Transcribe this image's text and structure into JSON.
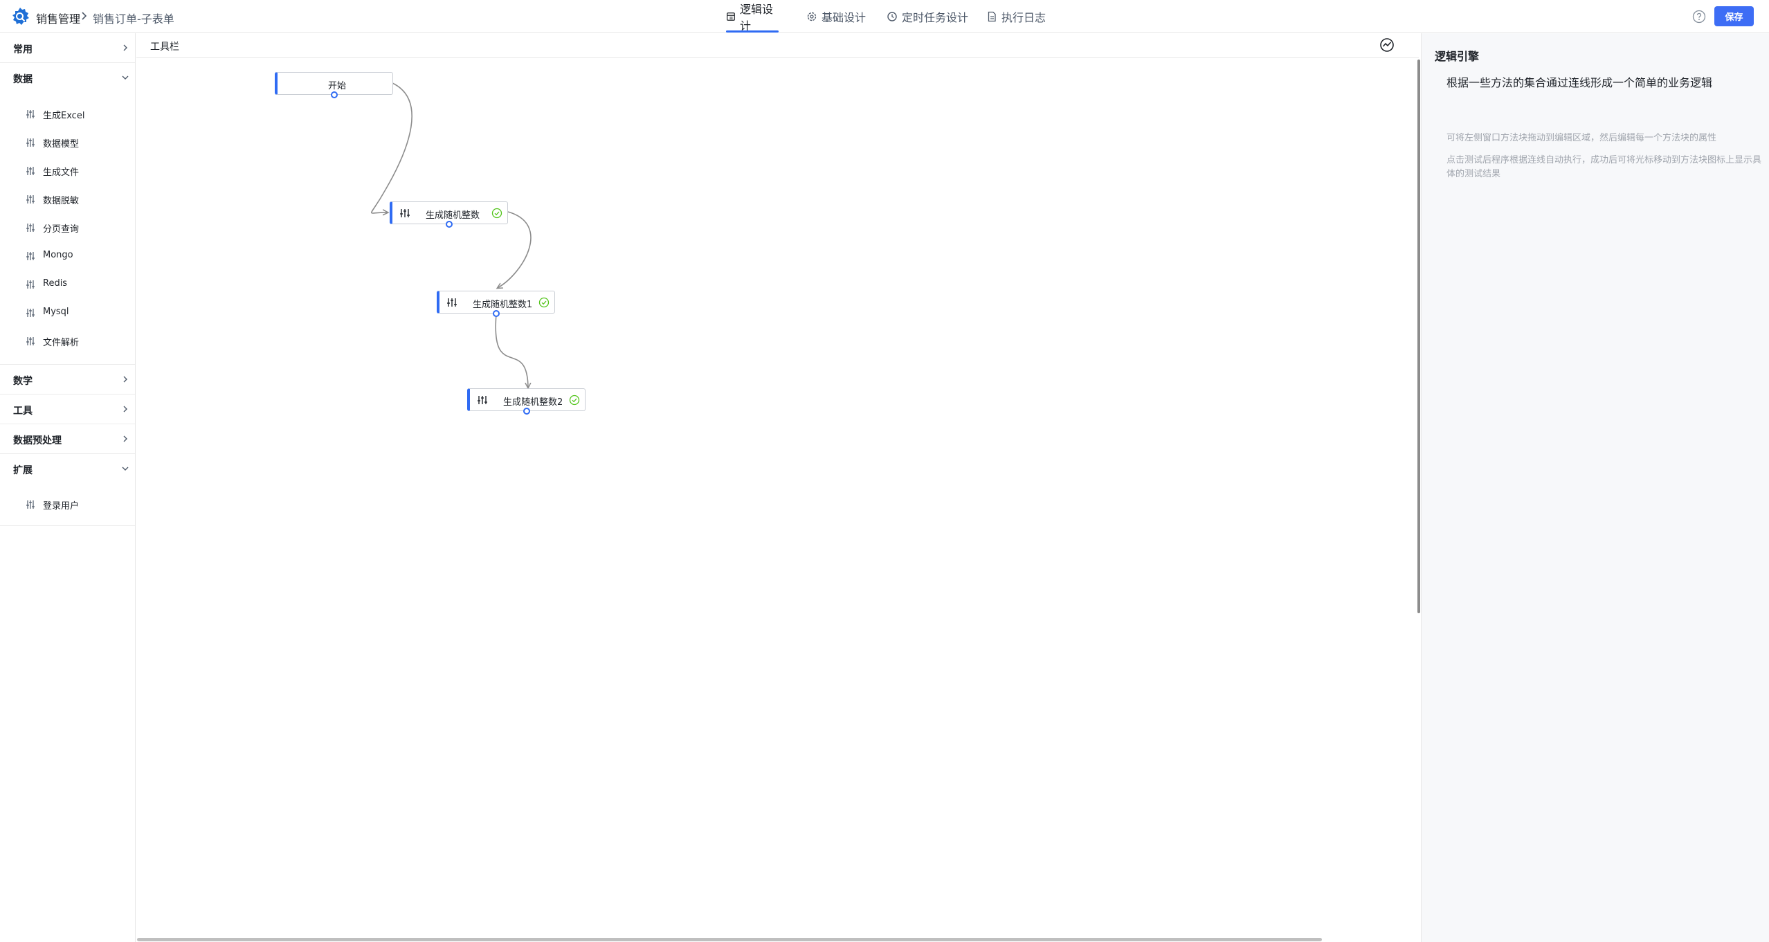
{
  "header": {
    "app_name": "销售管理",
    "page_name": "销售订单-子表单",
    "tabs": [
      {
        "label": "逻辑设计",
        "icon": "layout-icon",
        "active": true
      },
      {
        "label": "基础设计",
        "icon": "gear-icon",
        "active": false
      },
      {
        "label": "定时任务设计",
        "icon": "clock-icon",
        "active": false
      },
      {
        "label": "执行日志",
        "icon": "document-icon",
        "active": false
      }
    ],
    "save_label": "保存",
    "accent_color": "#3d6df5"
  },
  "sidebar": {
    "groups": [
      {
        "label": "常用",
        "expanded": false,
        "items": []
      },
      {
        "label": "数据",
        "expanded": true,
        "items": [
          {
            "label": "生成Excel"
          },
          {
            "label": "数据模型"
          },
          {
            "label": "生成文件"
          },
          {
            "label": "数据脱敏"
          },
          {
            "label": "分页查询"
          },
          {
            "label": "Mongo"
          },
          {
            "label": "Redis"
          },
          {
            "label": "Mysql"
          },
          {
            "label": "文件解析"
          }
        ]
      },
      {
        "label": "数学",
        "expanded": false,
        "items": []
      },
      {
        "label": "工具",
        "expanded": false,
        "items": []
      },
      {
        "label": "数据预处理",
        "expanded": false,
        "items": []
      },
      {
        "label": "扩展",
        "expanded": true,
        "items": [
          {
            "label": "登录用户"
          }
        ]
      }
    ]
  },
  "canvas": {
    "toolbar_label": "工具栏",
    "nodes": [
      {
        "label": "开始",
        "type": "start",
        "status": ""
      },
      {
        "label": "生成随机整数",
        "type": "method",
        "status": "success"
      },
      {
        "label": "生成随机整数1",
        "type": "method",
        "status": "success"
      },
      {
        "label": "生成随机整数2",
        "type": "method",
        "status": "success"
      }
    ]
  },
  "right_panel": {
    "title": "逻辑引擎",
    "subtitle": "根据一些方法的集合通过连线形成一个简单的业务逻辑",
    "tip1": "可将左侧窗口方法块拖动到编辑区域，然后编辑每一个方法块的属性",
    "tip2": "点击测试后程序根据连线自动执行，成功后可将光标移动到方法块图标上显示具体的测试结果"
  }
}
